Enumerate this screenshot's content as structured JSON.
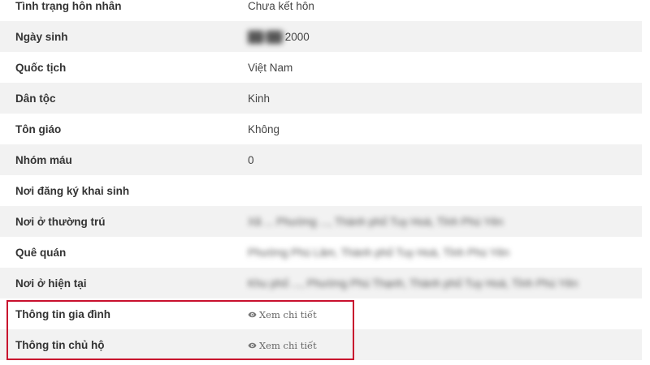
{
  "rows": [
    {
      "label": "Tình trạng hôn nhân",
      "value": "Chưa kết hôn"
    },
    {
      "label": "Ngày sinh",
      "value": "2000"
    },
    {
      "label": "Quốc tịch",
      "value": "Việt Nam"
    },
    {
      "label": "Dân tộc",
      "value": "Kinh"
    },
    {
      "label": "Tôn giáo",
      "value": "Không"
    },
    {
      "label": "Nhóm máu",
      "value": "0"
    },
    {
      "label": "Nơi đăng ký khai sinh",
      "value": ""
    },
    {
      "label": "Nơi ở thường trú",
      "value_hidden": "Xã ... Phường ..., Thành phố Tuy Hoà, Tỉnh Phú Yên"
    },
    {
      "label": "Quê quán",
      "value_hidden": "Phường Phú Lâm, Thành phố Tuy Hoà, Tỉnh Phú Yên"
    },
    {
      "label": "Nơi ở hiện tại",
      "value_hidden": "Khu phố ..., Phường Phú Thạnh, Thành phố Tuy Hoà, Tỉnh Phú Yên"
    },
    {
      "label": "Thông tin gia đình",
      "link": "Xem chi tiết"
    },
    {
      "label": "Thông tin chủ hộ",
      "link": "Xem chi tiết"
    }
  ],
  "icons": {
    "view": "eye-icon"
  },
  "colors": {
    "highlight": "#c8102e",
    "row_alt": "#f2f2f2"
  }
}
